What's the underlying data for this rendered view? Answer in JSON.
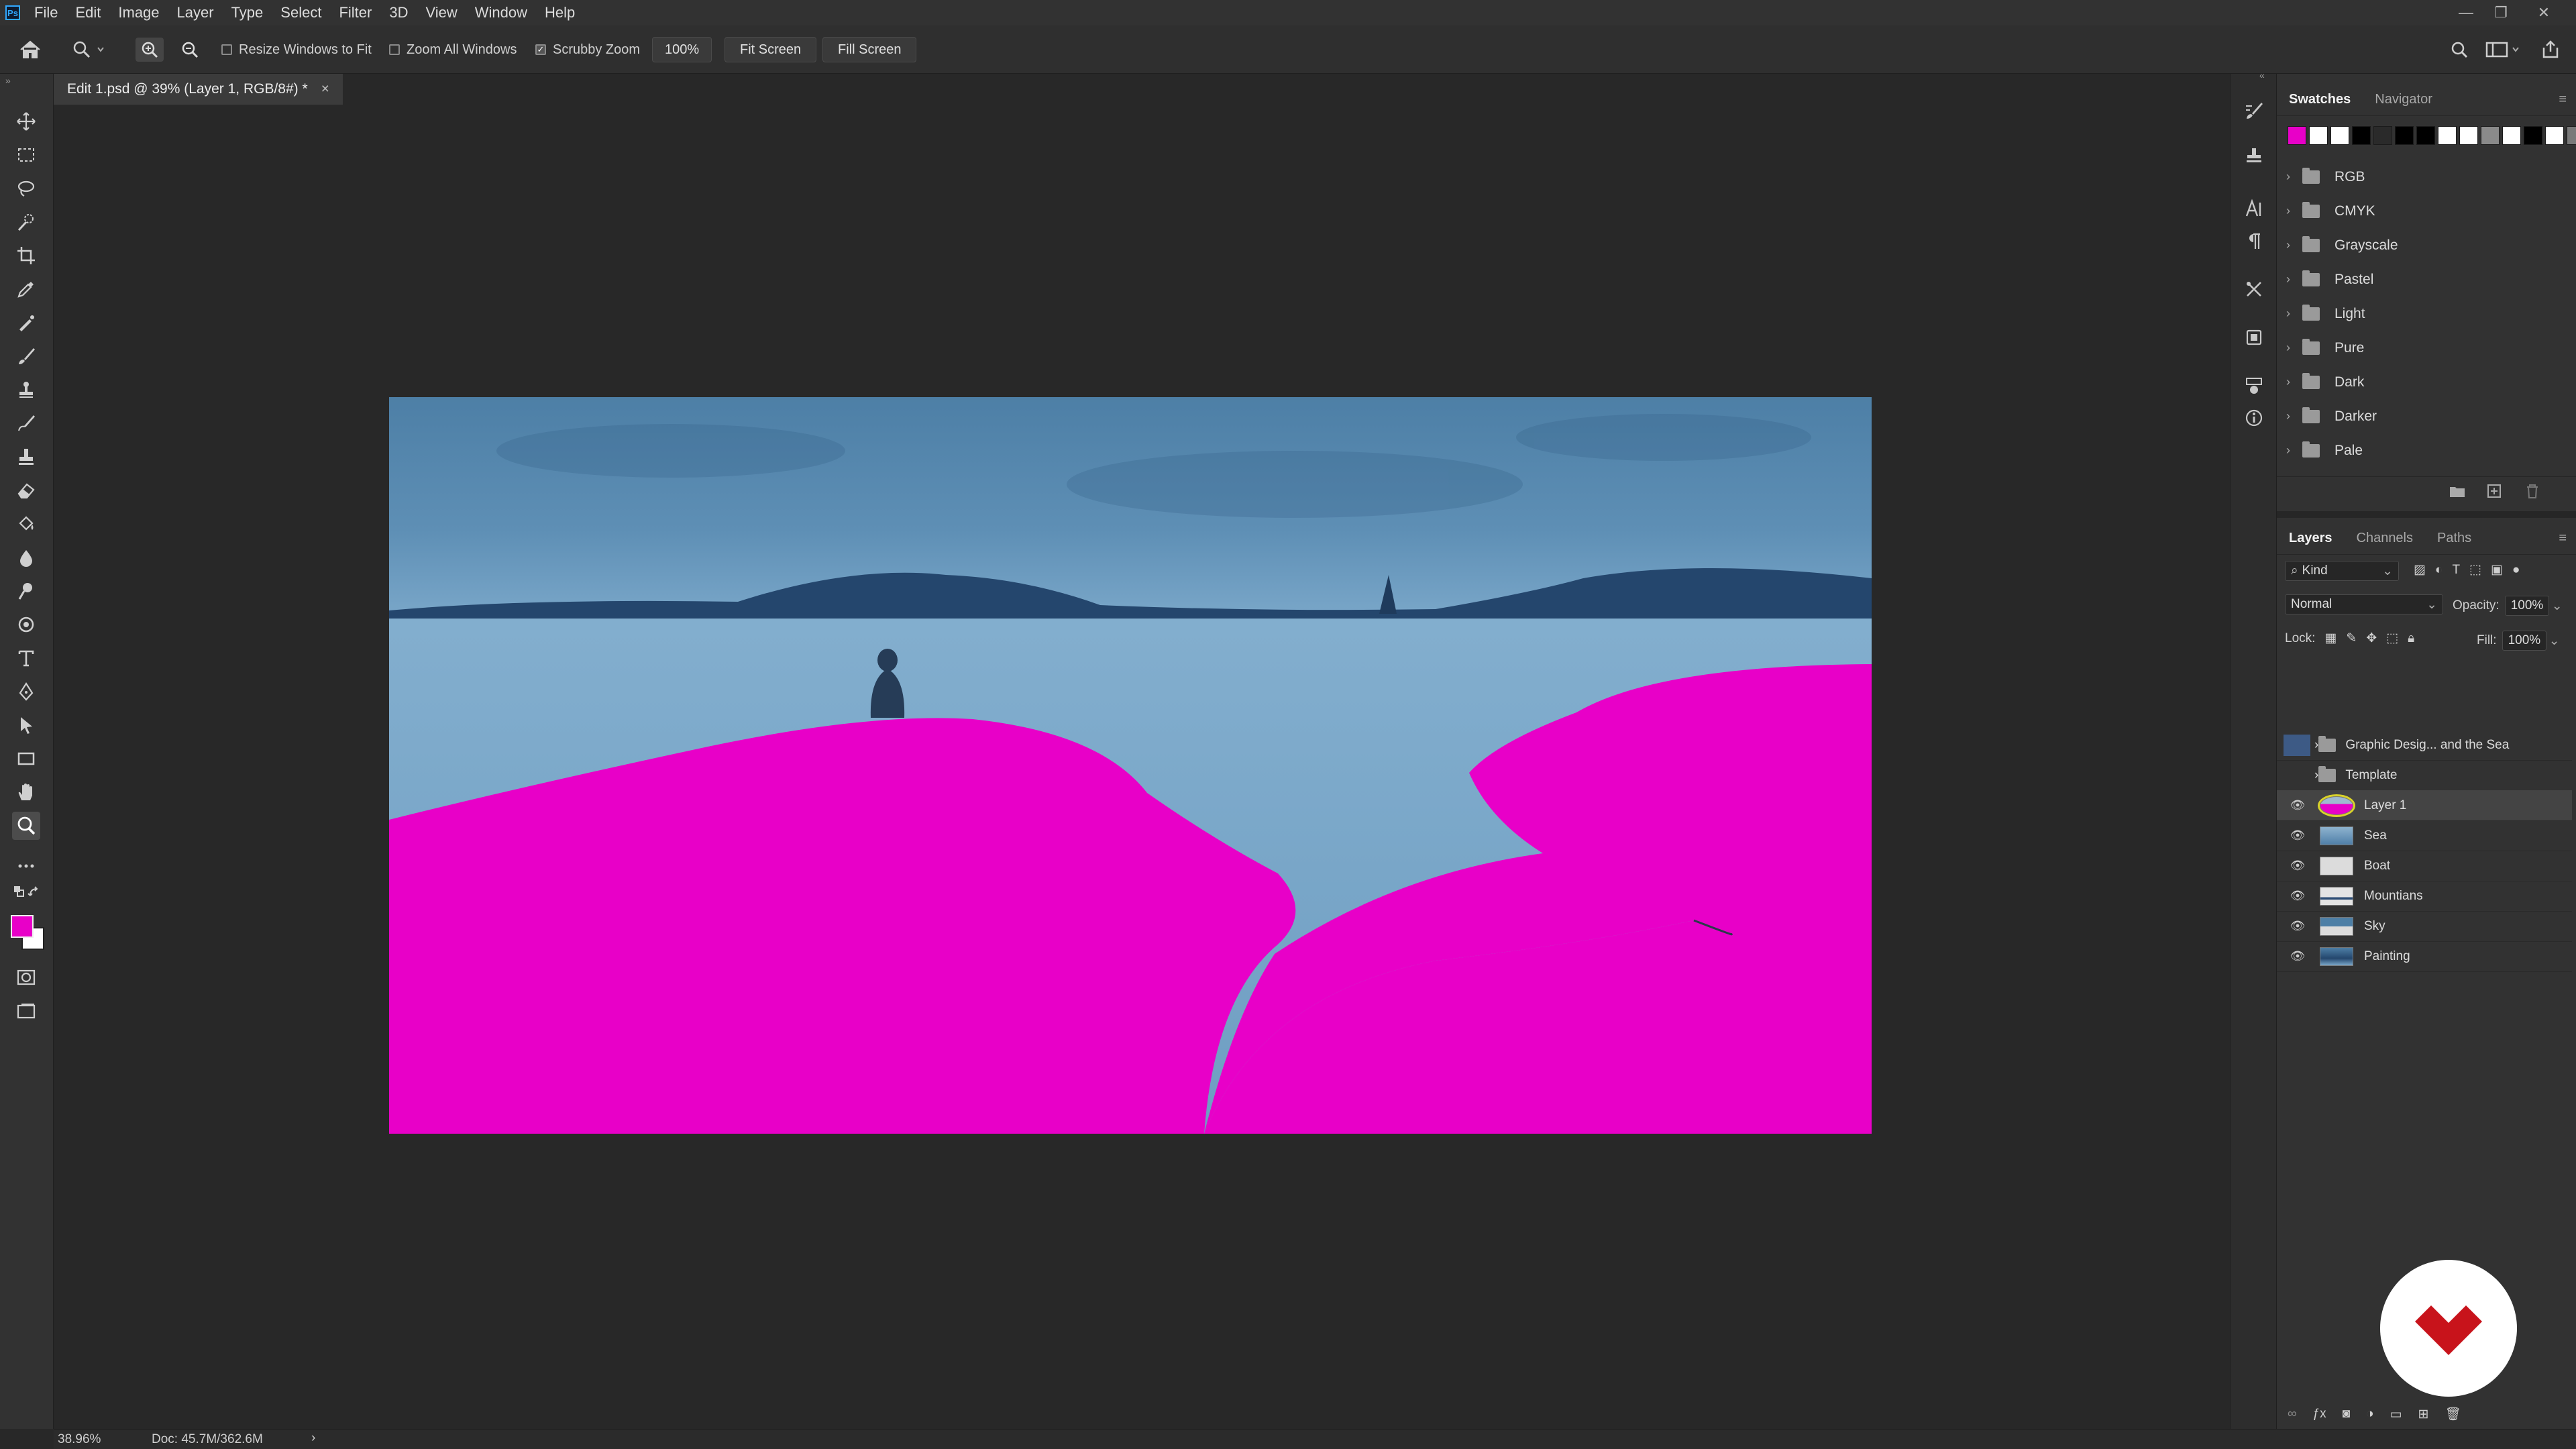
{
  "app": {
    "logo_text": "Ps"
  },
  "menu": [
    "File",
    "Edit",
    "Image",
    "Layer",
    "Type",
    "Select",
    "Filter",
    "3D",
    "View",
    "Window",
    "Help"
  ],
  "window_controls": {
    "minimize": "—",
    "restore": "❐",
    "close": "✕"
  },
  "options_bar": {
    "resize_windows": "Resize Windows to Fit",
    "zoom_all": "Zoom All Windows",
    "scrubby_zoom": "Scrubby Zoom",
    "zoom_value": "100%",
    "fit_screen": "Fit Screen",
    "fill_screen": "Fill Screen"
  },
  "document_tab": {
    "title": "Edit 1.psd @ 39% (Layer 1, RGB/8#) *",
    "close": "×"
  },
  "swatches_panel": {
    "tabs": [
      "Swatches",
      "Navigator"
    ],
    "colors": [
      "#e800c8",
      "#ffffff",
      "#ffffff",
      "#000000",
      "#2a2a2a",
      "#000000",
      "#000000",
      "#ffffff",
      "#ffffff",
      "#8a8a8a",
      "#ffffff",
      "#000000",
      "#ffffff",
      "#7a7a7a",
      "#ffffff"
    ],
    "groups": [
      "RGB",
      "CMYK",
      "Grayscale",
      "Pastel",
      "Light",
      "Pure",
      "Dark",
      "Darker",
      "Pale"
    ]
  },
  "layers_panel": {
    "tabs": [
      "Layers",
      "Channels",
      "Paths"
    ],
    "filter": "Kind",
    "blend_mode": "Normal",
    "opacity_label": "Opacity:",
    "opacity": "100%",
    "lock_label": "Lock:",
    "fill_label": "Fill:",
    "fill": "100%",
    "groups": [
      "Graphic Desig... and the Sea",
      "Template"
    ],
    "layers": [
      "Layer 1",
      "Sea",
      "Boat",
      "Mountians",
      "Sky",
      "Painting"
    ]
  },
  "status": {
    "zoom": "38.96%",
    "doc": "Doc: 45.7M/362.6M",
    "arrow": "›"
  }
}
